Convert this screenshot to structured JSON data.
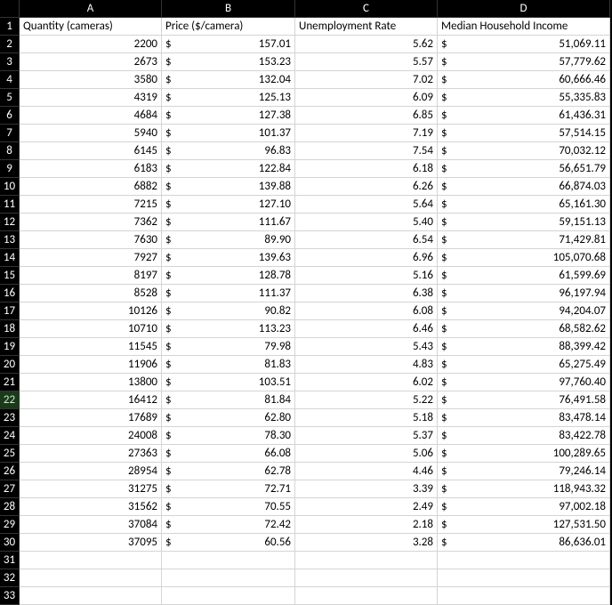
{
  "columns": [
    "A",
    "B",
    "C",
    "D"
  ],
  "headers": {
    "A": "Quantity (cameras)",
    "B": "Price ($/camera)",
    "C": "Unemployment Rate",
    "D": "Median Household Income"
  },
  "currency_symbol": "$",
  "selected_row": 22,
  "rows": [
    {
      "n": 2,
      "qty": "2200",
      "price": "157.01",
      "unemp": "5.62",
      "income": "51,069.11"
    },
    {
      "n": 3,
      "qty": "2673",
      "price": "153.23",
      "unemp": "5.57",
      "income": "57,779.62"
    },
    {
      "n": 4,
      "qty": "3580",
      "price": "132.04",
      "unemp": "7.02",
      "income": "60,666.46"
    },
    {
      "n": 5,
      "qty": "4319",
      "price": "125.13",
      "unemp": "6.09",
      "income": "55,335.83"
    },
    {
      "n": 6,
      "qty": "4684",
      "price": "127.38",
      "unemp": "6.85",
      "income": "61,436.31"
    },
    {
      "n": 7,
      "qty": "5940",
      "price": "101.37",
      "unemp": "7.19",
      "income": "57,514.15"
    },
    {
      "n": 8,
      "qty": "6145",
      "price": "96.83",
      "unemp": "7.54",
      "income": "70,032.12"
    },
    {
      "n": 9,
      "qty": "6183",
      "price": "122.84",
      "unemp": "6.18",
      "income": "56,651.79"
    },
    {
      "n": 10,
      "qty": "6882",
      "price": "139.88",
      "unemp": "6.26",
      "income": "66,874.03"
    },
    {
      "n": 11,
      "qty": "7215",
      "price": "127.10",
      "unemp": "5.64",
      "income": "65,161.30"
    },
    {
      "n": 12,
      "qty": "7362",
      "price": "111.67",
      "unemp": "5.40",
      "income": "59,151.13"
    },
    {
      "n": 13,
      "qty": "7630",
      "price": "89.90",
      "unemp": "6.54",
      "income": "71,429.81"
    },
    {
      "n": 14,
      "qty": "7927",
      "price": "139.63",
      "unemp": "6.96",
      "income": "105,070.68"
    },
    {
      "n": 15,
      "qty": "8197",
      "price": "128.78",
      "unemp": "5.16",
      "income": "61,599.69"
    },
    {
      "n": 16,
      "qty": "8528",
      "price": "111.37",
      "unemp": "6.38",
      "income": "96,197.94"
    },
    {
      "n": 17,
      "qty": "10126",
      "price": "90.82",
      "unemp": "6.08",
      "income": "94,204.07"
    },
    {
      "n": 18,
      "qty": "10710",
      "price": "113.23",
      "unemp": "6.46",
      "income": "68,582.62"
    },
    {
      "n": 19,
      "qty": "11545",
      "price": "79.98",
      "unemp": "5.43",
      "income": "88,399.42"
    },
    {
      "n": 20,
      "qty": "11906",
      "price": "81.83",
      "unemp": "4.83",
      "income": "65,275.49"
    },
    {
      "n": 21,
      "qty": "13800",
      "price": "103.51",
      "unemp": "6.02",
      "income": "97,760.40"
    },
    {
      "n": 22,
      "qty": "16412",
      "price": "81.84",
      "unemp": "5.22",
      "income": "76,491.58"
    },
    {
      "n": 23,
      "qty": "17689",
      "price": "62.80",
      "unemp": "5.18",
      "income": "83,478.14"
    },
    {
      "n": 24,
      "qty": "24008",
      "price": "78.30",
      "unemp": "5.37",
      "income": "83,422.78"
    },
    {
      "n": 25,
      "qty": "27363",
      "price": "66.08",
      "unemp": "5.06",
      "income": "100,289.65"
    },
    {
      "n": 26,
      "qty": "28954",
      "price": "62.78",
      "unemp": "4.46",
      "income": "79,246.14"
    },
    {
      "n": 27,
      "qty": "31275",
      "price": "72.71",
      "unemp": "3.39",
      "income": "118,943.32"
    },
    {
      "n": 28,
      "qty": "31562",
      "price": "70.55",
      "unemp": "2.49",
      "income": "97,002.18"
    },
    {
      "n": 29,
      "qty": "37084",
      "price": "72.42",
      "unemp": "2.18",
      "income": "127,531.50"
    },
    {
      "n": 30,
      "qty": "37095",
      "price": "60.56",
      "unemp": "3.28",
      "income": "86,636.01"
    }
  ],
  "empty_rows": [
    31,
    32,
    33
  ]
}
